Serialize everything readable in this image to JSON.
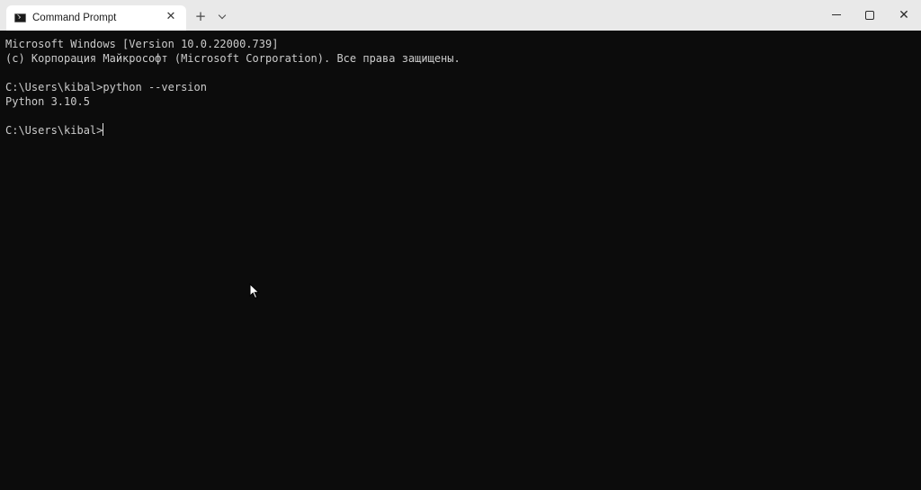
{
  "tab": {
    "title": "Command Prompt",
    "icon": "cmd-icon",
    "close_glyph": "✕"
  },
  "toolbar": {
    "new_tab_glyph": "+",
    "dropdown_icon": "chevron-down-icon"
  },
  "window_controls": {
    "close_glyph": "✕"
  },
  "terminal": {
    "lines": [
      "Microsoft Windows [Version 10.0.22000.739]",
      "(c) Корпорация Майкрософт (Microsoft Corporation). Все права защищены.",
      "",
      "C:\\Users\\kibal>python --version",
      "Python 3.10.5",
      "",
      "C:\\Users\\kibal>"
    ]
  },
  "colors": {
    "terminal_bg": "#0c0c0c",
    "terminal_fg": "#cccccc",
    "titlebar_bg": "#e9e9e9",
    "tab_bg": "#ffffff"
  }
}
